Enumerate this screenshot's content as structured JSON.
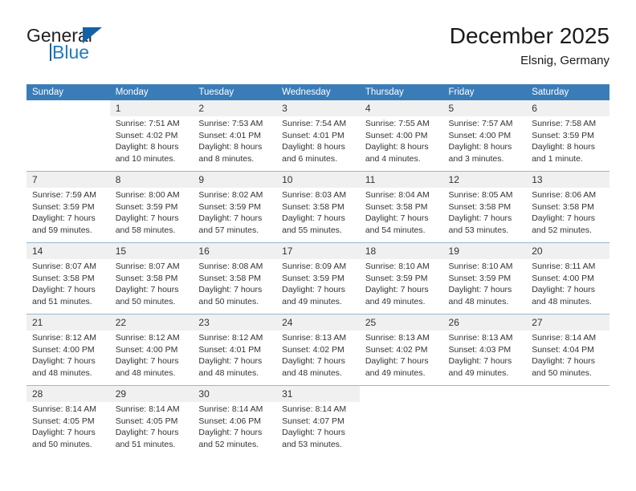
{
  "brand": {
    "name_top": "General",
    "name_bottom": "Blue",
    "accent_color": "#1f7ac4",
    "triangle_color": "#1462a6",
    "triangle_icon": "triangle-icon"
  },
  "header": {
    "month_title": "December 2025",
    "location": "Elsnig, Germany",
    "header_bg": "#3a7cb8",
    "header_text_color": "#ffffff"
  },
  "weekday_headers": [
    "Sunday",
    "Monday",
    "Tuesday",
    "Wednesday",
    "Thursday",
    "Friday",
    "Saturday"
  ],
  "labels": {
    "sunrise_prefix": "Sunrise:",
    "sunset_prefix": "Sunset:",
    "daylight_prefix": "Daylight:"
  },
  "weeks": [
    [
      {
        "day": "",
        "sunrise": "",
        "sunset": "",
        "daylight": "",
        "blank": true
      },
      {
        "day": "1",
        "sunrise": "Sunrise: 7:51 AM",
        "sunset": "Sunset: 4:02 PM",
        "daylight": "Daylight: 8 hours and 10 minutes."
      },
      {
        "day": "2",
        "sunrise": "Sunrise: 7:53 AM",
        "sunset": "Sunset: 4:01 PM",
        "daylight": "Daylight: 8 hours and 8 minutes."
      },
      {
        "day": "3",
        "sunrise": "Sunrise: 7:54 AM",
        "sunset": "Sunset: 4:01 PM",
        "daylight": "Daylight: 8 hours and 6 minutes."
      },
      {
        "day": "4",
        "sunrise": "Sunrise: 7:55 AM",
        "sunset": "Sunset: 4:00 PM",
        "daylight": "Daylight: 8 hours and 4 minutes."
      },
      {
        "day": "5",
        "sunrise": "Sunrise: 7:57 AM",
        "sunset": "Sunset: 4:00 PM",
        "daylight": "Daylight: 8 hours and 3 minutes."
      },
      {
        "day": "6",
        "sunrise": "Sunrise: 7:58 AM",
        "sunset": "Sunset: 3:59 PM",
        "daylight": "Daylight: 8 hours and 1 minute."
      }
    ],
    [
      {
        "day": "7",
        "sunrise": "Sunrise: 7:59 AM",
        "sunset": "Sunset: 3:59 PM",
        "daylight": "Daylight: 7 hours and 59 minutes."
      },
      {
        "day": "8",
        "sunrise": "Sunrise: 8:00 AM",
        "sunset": "Sunset: 3:59 PM",
        "daylight": "Daylight: 7 hours and 58 minutes."
      },
      {
        "day": "9",
        "sunrise": "Sunrise: 8:02 AM",
        "sunset": "Sunset: 3:59 PM",
        "daylight": "Daylight: 7 hours and 57 minutes."
      },
      {
        "day": "10",
        "sunrise": "Sunrise: 8:03 AM",
        "sunset": "Sunset: 3:58 PM",
        "daylight": "Daylight: 7 hours and 55 minutes."
      },
      {
        "day": "11",
        "sunrise": "Sunrise: 8:04 AM",
        "sunset": "Sunset: 3:58 PM",
        "daylight": "Daylight: 7 hours and 54 minutes."
      },
      {
        "day": "12",
        "sunrise": "Sunrise: 8:05 AM",
        "sunset": "Sunset: 3:58 PM",
        "daylight": "Daylight: 7 hours and 53 minutes."
      },
      {
        "day": "13",
        "sunrise": "Sunrise: 8:06 AM",
        "sunset": "Sunset: 3:58 PM",
        "daylight": "Daylight: 7 hours and 52 minutes."
      }
    ],
    [
      {
        "day": "14",
        "sunrise": "Sunrise: 8:07 AM",
        "sunset": "Sunset: 3:58 PM",
        "daylight": "Daylight: 7 hours and 51 minutes."
      },
      {
        "day": "15",
        "sunrise": "Sunrise: 8:07 AM",
        "sunset": "Sunset: 3:58 PM",
        "daylight": "Daylight: 7 hours and 50 minutes."
      },
      {
        "day": "16",
        "sunrise": "Sunrise: 8:08 AM",
        "sunset": "Sunset: 3:58 PM",
        "daylight": "Daylight: 7 hours and 50 minutes."
      },
      {
        "day": "17",
        "sunrise": "Sunrise: 8:09 AM",
        "sunset": "Sunset: 3:59 PM",
        "daylight": "Daylight: 7 hours and 49 minutes."
      },
      {
        "day": "18",
        "sunrise": "Sunrise: 8:10 AM",
        "sunset": "Sunset: 3:59 PM",
        "daylight": "Daylight: 7 hours and 49 minutes."
      },
      {
        "day": "19",
        "sunrise": "Sunrise: 8:10 AM",
        "sunset": "Sunset: 3:59 PM",
        "daylight": "Daylight: 7 hours and 48 minutes."
      },
      {
        "day": "20",
        "sunrise": "Sunrise: 8:11 AM",
        "sunset": "Sunset: 4:00 PM",
        "daylight": "Daylight: 7 hours and 48 minutes."
      }
    ],
    [
      {
        "day": "21",
        "sunrise": "Sunrise: 8:12 AM",
        "sunset": "Sunset: 4:00 PM",
        "daylight": "Daylight: 7 hours and 48 minutes."
      },
      {
        "day": "22",
        "sunrise": "Sunrise: 8:12 AM",
        "sunset": "Sunset: 4:00 PM",
        "daylight": "Daylight: 7 hours and 48 minutes."
      },
      {
        "day": "23",
        "sunrise": "Sunrise: 8:12 AM",
        "sunset": "Sunset: 4:01 PM",
        "daylight": "Daylight: 7 hours and 48 minutes."
      },
      {
        "day": "24",
        "sunrise": "Sunrise: 8:13 AM",
        "sunset": "Sunset: 4:02 PM",
        "daylight": "Daylight: 7 hours and 48 minutes."
      },
      {
        "day": "25",
        "sunrise": "Sunrise: 8:13 AM",
        "sunset": "Sunset: 4:02 PM",
        "daylight": "Daylight: 7 hours and 49 minutes."
      },
      {
        "day": "26",
        "sunrise": "Sunrise: 8:13 AM",
        "sunset": "Sunset: 4:03 PM",
        "daylight": "Daylight: 7 hours and 49 minutes."
      },
      {
        "day": "27",
        "sunrise": "Sunrise: 8:14 AM",
        "sunset": "Sunset: 4:04 PM",
        "daylight": "Daylight: 7 hours and 50 minutes."
      }
    ],
    [
      {
        "day": "28",
        "sunrise": "Sunrise: 8:14 AM",
        "sunset": "Sunset: 4:05 PM",
        "daylight": "Daylight: 7 hours and 50 minutes."
      },
      {
        "day": "29",
        "sunrise": "Sunrise: 8:14 AM",
        "sunset": "Sunset: 4:05 PM",
        "daylight": "Daylight: 7 hours and 51 minutes."
      },
      {
        "day": "30",
        "sunrise": "Sunrise: 8:14 AM",
        "sunset": "Sunset: 4:06 PM",
        "daylight": "Daylight: 7 hours and 52 minutes."
      },
      {
        "day": "31",
        "sunrise": "Sunrise: 8:14 AM",
        "sunset": "Sunset: 4:07 PM",
        "daylight": "Daylight: 7 hours and 53 minutes."
      },
      {
        "day": "",
        "sunrise": "",
        "sunset": "",
        "daylight": "",
        "blank": true
      },
      {
        "day": "",
        "sunrise": "",
        "sunset": "",
        "daylight": "",
        "blank": true
      },
      {
        "day": "",
        "sunrise": "",
        "sunset": "",
        "daylight": "",
        "blank": true
      }
    ]
  ]
}
